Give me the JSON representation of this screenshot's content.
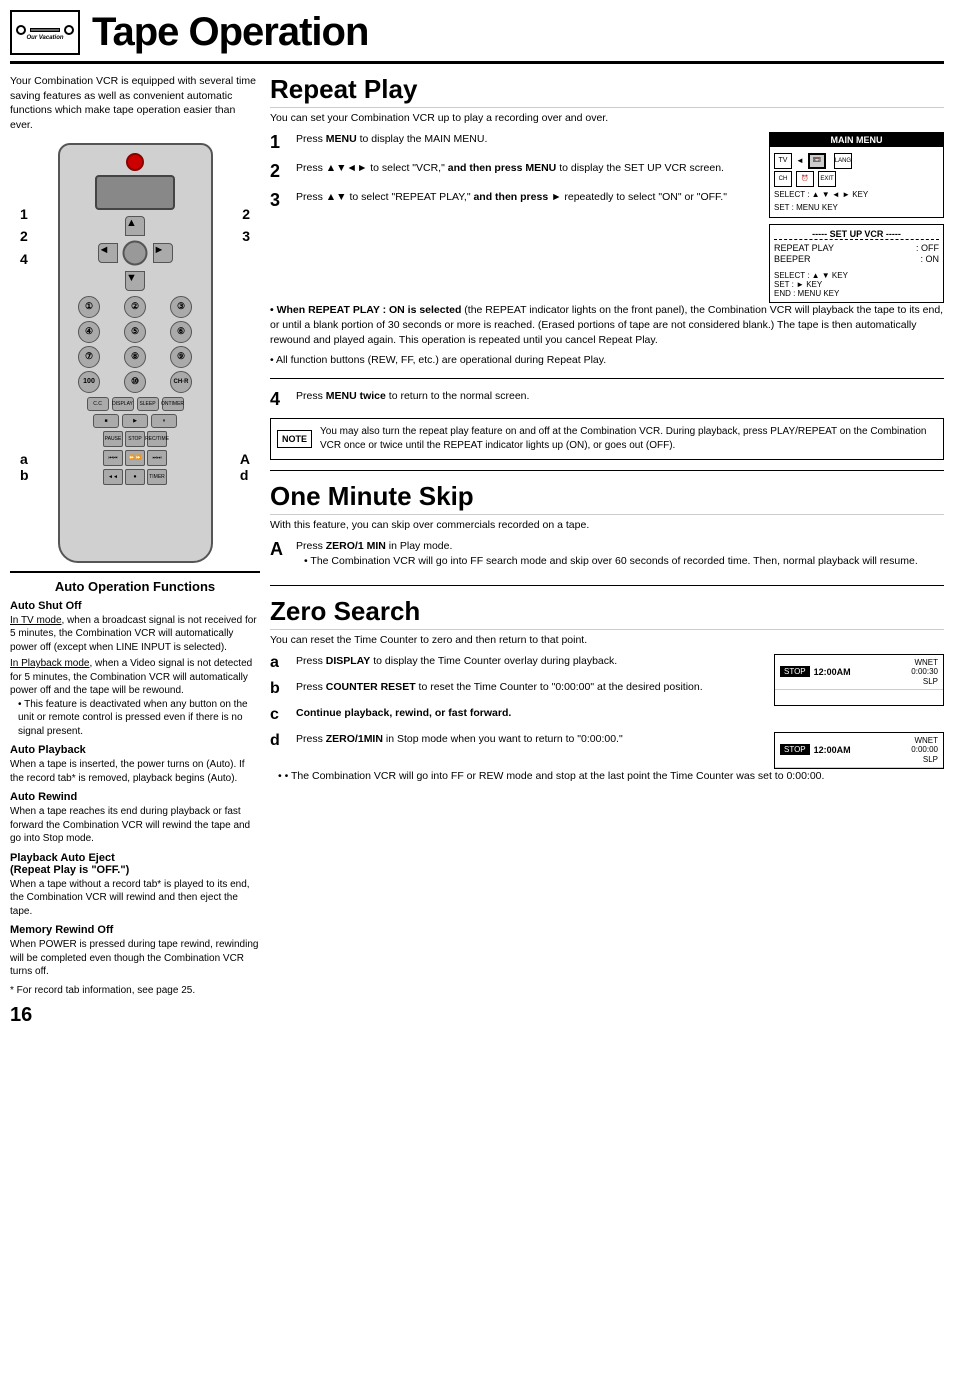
{
  "header": {
    "title": "Tape Operation",
    "icon_alt": "VCR tape icon",
    "icon_sublabel": "Our Vacation"
  },
  "intro": {
    "text": "Your Combination VCR is equipped with several time saving features as well as convenient automatic functions which make tape operation easier than ever."
  },
  "remote_labels": {
    "left": [
      "1",
      "2",
      "4"
    ],
    "right": [
      "2",
      "3"
    ],
    "bottom_left": [
      "a",
      "b"
    ],
    "bottom_right": [
      "A",
      "d"
    ]
  },
  "auto_section": {
    "title": "Auto Operation Functions",
    "subsections": [
      {
        "heading": "Auto Shut Off",
        "paragraphs": [
          "In TV mode, when a broadcast signal is not received for 5 minutes, the Combination VCR will automatically power off (except when LINE INPUT is selected).",
          "In Playback mode, when a Video signal is not detected for 5 minutes, the Combination VCR will automatically power off and the tape will be rewound."
        ],
        "bullets": [
          "This feature is deactivated when any button on the unit or remote control is pressed even if there is no signal present."
        ]
      },
      {
        "heading": "Auto Playback",
        "paragraphs": [
          "When a tape is inserted, the power turns on (Auto). If the record tab* is removed, playback begins (Auto)."
        ]
      },
      {
        "heading": "Auto Rewind",
        "paragraphs": [
          "When a tape reaches its end during playback or fast forward the Combination VCR will rewind the tape and go into Stop mode."
        ]
      },
      {
        "heading": "Playback Auto Eject",
        "subheading": "(Repeat Play is \"OFF.\")",
        "paragraphs": [
          "When a tape without a record tab* is played to its end, the Combination VCR will rewind and then eject the tape."
        ]
      },
      {
        "heading": "Memory Rewind Off",
        "paragraphs": [
          "When POWER is pressed during tape rewind, rewinding will be completed even though the Combination VCR turns off."
        ]
      }
    ],
    "footnote": "* For record tab information, see page 25."
  },
  "repeat_play": {
    "section_title": "Repeat Play",
    "subtitle": "You can set your Combination VCR up to play a recording over and over.",
    "steps": [
      {
        "num": "1",
        "text": "Press MENU to display the MAIN MENU."
      },
      {
        "num": "2",
        "text": "Press ▲▼◄► to select \"VCR,\" and then press MENU to display the SET UP VCR screen."
      },
      {
        "num": "3",
        "text_before": "Press ▲▼ to select \"REPEAT PLAY,\" and then press ►",
        "text_after": "repeatedly to select \"ON\" or \"OFF.\""
      }
    ],
    "when_on_heading": "• When REPEAT PLAY : ON is selected",
    "when_on_text": "(the REPEAT indicator lights on the front panel), the Combination VCR will playback the tape to its end, or until a blank portion of 30 seconds or more is reached. (Erased portions of tape are not considered blank.) The tape is then automatically rewound and played again. This operation is repeated until you cancel Repeat Play.",
    "all_functions_bullet": "• All function buttons (REW, FF, etc.) are operational during Repeat Play.",
    "step4": {
      "num": "4",
      "text": "Press MENU twice to return to the normal screen."
    },
    "note_text": "You may also turn the repeat play feature on and off at the Combination VCR. During playback, press PLAY/REPEAT on the Combination VCR once or twice until the REPEAT indicator lights up (ON), or goes out (OFF).",
    "note_label": "NOTE",
    "main_menu_box": {
      "title": "MAIN MENU",
      "icons": [
        "TV",
        "VCR",
        "LANGUAGE"
      ],
      "icons2": [
        "CH",
        "CLOCK",
        "EXIT"
      ],
      "select_line": "SELECT : ▲ ▼ ◄ ► KEY",
      "set_line": "SET    : MENU KEY"
    },
    "setup_vcr_box": {
      "title": "----- SET UP VCR -----",
      "rows": [
        {
          "label": "REPEAT PLAY",
          "value": ": OFF"
        },
        {
          "label": "BEEPER",
          "value": ": ON"
        }
      ],
      "select_line": "SELECT : ▲ ▼  KEY",
      "set_line": "SET    : ► KEY",
      "end_line": "END    : MENU KEY"
    }
  },
  "one_minute_skip": {
    "section_title": "One Minute Skip",
    "subtitle": "With this feature, you can skip over commercials recorded on a tape.",
    "step_A": {
      "label": "A",
      "text": "Press ZERO/1 MIN in Play mode.",
      "bullet": "The Combination VCR will go into FF search mode and skip over 60 seconds of recorded time. Then, normal playback will resume."
    }
  },
  "zero_search": {
    "section_title": "Zero Search",
    "subtitle": "You can reset the Time Counter to zero and then return to that point.",
    "steps": [
      {
        "label": "a",
        "text": "Press DISPLAY to display the Time Counter overlay during playback.",
        "display": {
          "status": "STOP",
          "time": "12:00AM",
          "channel": "WNET",
          "counter": "0:00:30",
          "slp": "SLP"
        }
      },
      {
        "label": "b",
        "text": "Press COUNTER RESET to reset the Time Counter to \"0:00:00\" at the desired position."
      },
      {
        "label": "c",
        "text": "Continue playback, rewind, or fast forward."
      },
      {
        "label": "d",
        "text": "Press ZERO/1MIN in Stop mode when you want to return to \"0:00:00.\"",
        "display": {
          "status": "STOP",
          "time": "12:00AM",
          "channel": "WNET",
          "counter": "0:00:00",
          "slp": "SLP"
        }
      }
    ],
    "final_bullet": "• The Combination VCR will go into FF or REW mode and stop at the last point the Time Counter was set to 0:00:00."
  },
  "page_number": "16"
}
